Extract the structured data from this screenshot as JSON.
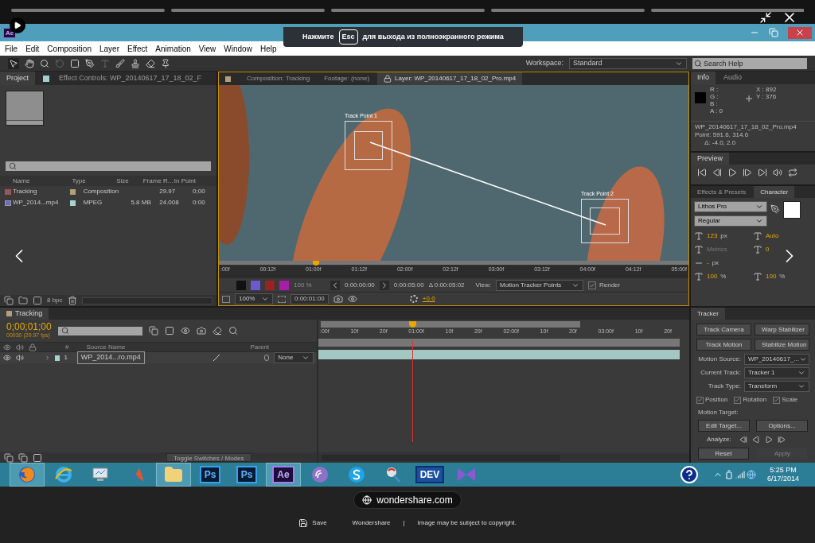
{
  "fullscreen_notice": {
    "before": "Нажмите",
    "key": "Esc",
    "after": "для выхода из полноэкранного режима"
  },
  "app": {
    "logo": "Ae"
  },
  "menu": [
    "File",
    "Edit",
    "Composition",
    "Layer",
    "Effect",
    "Animation",
    "View",
    "Window",
    "Help"
  ],
  "workspace": {
    "label": "Workspace:",
    "value": "Standard"
  },
  "search_help": {
    "placeholder": "Search Help"
  },
  "project_panel": {
    "tabs": [
      {
        "label": "Project",
        "selected": true
      },
      {
        "label": "Effect Controls: WP_20140617_17_18_02_F",
        "selected": false
      }
    ],
    "columns": [
      "Name",
      "Type",
      "Size",
      "Frame R...",
      "In Point"
    ],
    "rows": [
      {
        "kind": "composition",
        "name": "Tracking",
        "color": "#b39f7a",
        "type": "Composition",
        "frame_rate": "29.97",
        "in_point": "0;00"
      },
      {
        "kind": "footage",
        "name": "WP_2014...mp4",
        "color": "#a6d4cd",
        "type": "MPEG",
        "size": "5.8 MB",
        "frame_rate": "24.008",
        "in_point": "0:00"
      }
    ],
    "bpc": "8 bpc"
  },
  "viewer_panel": {
    "tabs": [
      {
        "label": "Composition: Tracking",
        "selected": false
      },
      {
        "label": "Footage: (none)",
        "selected": false
      },
      {
        "label": "Layer: WP_20140617_17_18_02_Pro.mp4",
        "selected": true
      }
    ],
    "track_points": [
      {
        "label": "Track Point 1"
      },
      {
        "label": "Track Point 2"
      }
    ],
    "ruler": [
      ":00f",
      "00:12f",
      "01:00f",
      "01:12f",
      "02:00f",
      "02:12f",
      "03:00f",
      "03:12f",
      "04:00f",
      "04:12f",
      "05:00f"
    ],
    "opacity": "100 %",
    "in_time": "0:00:00:00",
    "out_time": "0:00:05:00",
    "duration": "Δ 0:00:05:02",
    "view_label": "View:",
    "view_value": "Motion Tracker Points",
    "render": {
      "label": "Render",
      "checked": true
    },
    "zoom": "100%",
    "current_time": "0:00:01:00",
    "exposure": "+0.0"
  },
  "info_panel": {
    "tabs": [
      {
        "label": "Info",
        "selected": true
      },
      {
        "label": "Audio",
        "selected": false
      }
    ],
    "channels": [
      "R :",
      "G :",
      "B :",
      "A : 0"
    ],
    "x": "X : 892",
    "y": "Y : 376",
    "lines": [
      "WP_20140617_17_18_02_Pro.mp4",
      "Point: 591.6, 314.6",
      "Δ: -4.0, 2.0"
    ]
  },
  "preview_panel": {
    "tabs": [
      {
        "label": "Preview",
        "selected": true
      }
    ]
  },
  "character_panel": {
    "tabs": [
      {
        "label": "Effects & Presets",
        "selected": false
      },
      {
        "label": "Character",
        "selected": true
      }
    ],
    "font": "Lithos Pro",
    "style": "Regular",
    "size": "123",
    "size_unit": "px",
    "leading": "Auto",
    "kerning": "Metrics",
    "tracking": "0",
    "stroke": "-",
    "stroke_unit": "px",
    "vertical_scale": "100",
    "horizontal_scale": "100",
    "percent": "%"
  },
  "timeline": {
    "tab": {
      "label": "Tracking",
      "selected": true
    },
    "timecode": "0;00;01;00",
    "fps": "00030 (29.97 fps)",
    "columns": [
      "#",
      "Source Name",
      "Parent"
    ],
    "layers": [
      {
        "number": "1",
        "name": "WP_2014...ro.mp4",
        "parent": "None"
      }
    ],
    "ruler": [
      ":00f",
      "10f",
      "20f",
      "01:00f",
      "10f",
      "20f",
      "02:00f",
      "10f",
      "20f",
      "03:00f",
      "10f",
      "20f"
    ],
    "toggle": "Toggle Switches / Modes"
  },
  "tracker_panel": {
    "tab": {
      "label": "Tracker",
      "selected": true
    },
    "buttons": [
      "Track Camera",
      "Warp Stabilizer",
      "Track Motion",
      "Stabilize Motion"
    ],
    "fields": [
      {
        "label": "Motion Source:",
        "value": "WP_20140617_..."
      },
      {
        "label": "Current Track:",
        "value": "Tracker 1"
      },
      {
        "label": "Track Type:",
        "value": "Transform"
      }
    ],
    "checkboxes": [
      {
        "label": "Position",
        "checked": true
      },
      {
        "label": "Rotation",
        "checked": true
      },
      {
        "label": "Scale",
        "checked": true
      }
    ],
    "motion_target": "Motion Target:",
    "target_buttons": [
      "Edit Target...",
      "Options..."
    ],
    "analyze": "Analyze:",
    "actions": [
      {
        "label": "Reset",
        "disabled": false
      },
      {
        "label": "Apply",
        "disabled": true
      }
    ]
  },
  "taskbar": {
    "apps": [
      {
        "kind": "firefox",
        "selected": true
      },
      {
        "kind": "ie",
        "selected": false
      },
      {
        "kind": "monitor",
        "selected": false
      },
      {
        "kind": "matlab",
        "selected": false
      },
      {
        "kind": "folder",
        "selected": true
      },
      {
        "kind": "tile",
        "label": "Ps",
        "selected": false
      },
      {
        "kind": "tile",
        "label": "Ps",
        "selected": false
      },
      {
        "kind": "tile",
        "label": "Ae",
        "selected": true
      },
      {
        "kind": "torrent",
        "selected": false
      },
      {
        "kind": "skype",
        "selected": false
      },
      {
        "kind": "tool",
        "selected": false
      },
      {
        "kind": "tile",
        "label": "DEV",
        "selected": false
      },
      {
        "kind": "vs",
        "selected": false
      }
    ],
    "time": "5:25 PM",
    "date": "6/17/2014"
  },
  "image_viewer": {
    "source": "wondershare.com",
    "save": "Save",
    "site": "Wondershare",
    "separator": "|",
    "notice": "Image may be subject to copyright."
  }
}
